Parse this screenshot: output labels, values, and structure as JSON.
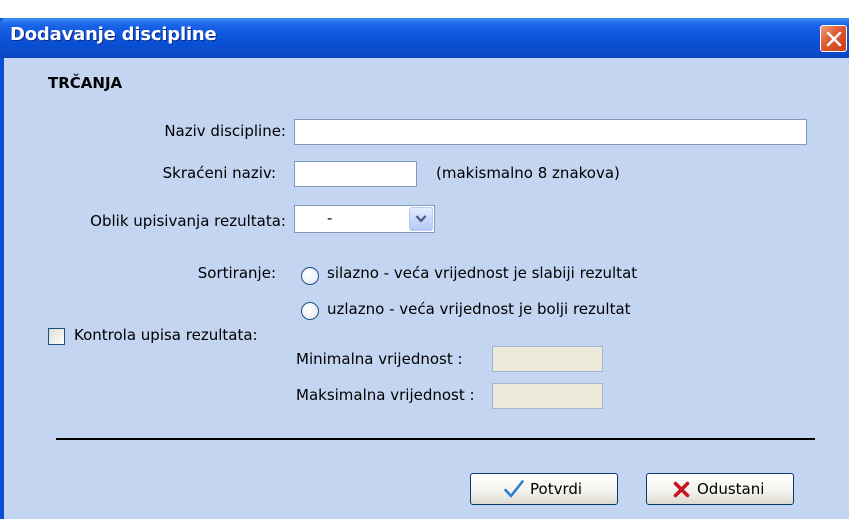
{
  "window": {
    "title": "Dodavanje discipline"
  },
  "section": {
    "title": "TRČANJA"
  },
  "fields": {
    "naziv": {
      "label": "Naziv discipline:",
      "value": ""
    },
    "skraceni": {
      "label": "Skraćeni naziv:",
      "value": "",
      "hint": "(makismalno 8 znakova)"
    },
    "oblik": {
      "label": "Oblik upisivanja rezultata:",
      "selected": "-"
    }
  },
  "sortiranje": {
    "label": "Sortiranje:",
    "options": [
      {
        "label": "silazno - veća vrijednost je slabiji rezultat",
        "checked": false
      },
      {
        "label": "uzlazno - veća vrijednost je bolji rezultat",
        "checked": false
      }
    ]
  },
  "kontrola": {
    "label": "Kontrola upisa rezultata:",
    "checked": false,
    "min_label": "Minimalna vrijednost :",
    "max_label": "Maksimalna vrijednost :",
    "min_value": "",
    "max_value": ""
  },
  "buttons": {
    "confirm": "Potvrdi",
    "cancel": "Odustani"
  },
  "colors": {
    "titlebar": "#0b52d8",
    "client": "#c3d5f1",
    "confirm_icon": "#2a7fd4",
    "cancel_icon": "#c8141e"
  },
  "icons": {
    "close": "close-icon",
    "dropdown": "chevron-down-icon",
    "confirm": "checkmark-icon",
    "cancel": "x-icon"
  }
}
